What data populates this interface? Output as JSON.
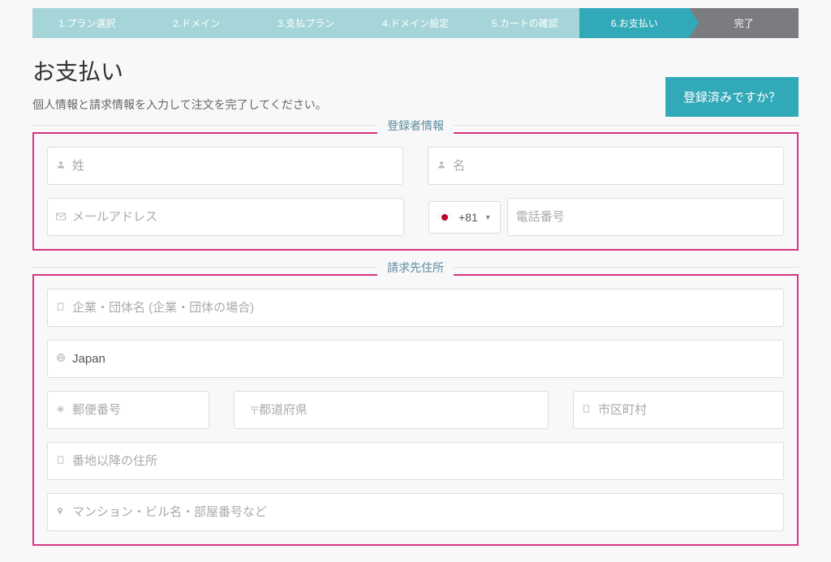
{
  "progress": {
    "steps": [
      {
        "label": "1.プラン選択",
        "state": "completed"
      },
      {
        "label": "2.ドメイン",
        "state": "completed"
      },
      {
        "label": "3.支払プラン",
        "state": "completed"
      },
      {
        "label": "4.ドメイン設定",
        "state": "completed"
      },
      {
        "label": "5.カートの確認",
        "state": "completed"
      },
      {
        "label": "6.お支払い",
        "state": "active"
      },
      {
        "label": "完了",
        "state": "inactive"
      }
    ]
  },
  "header": {
    "title": "お支払い",
    "subtitle": "個人情報と請求情報を入力して注文を完了してください。",
    "registered_button": "登録済みですか？"
  },
  "registrant_section": {
    "legend": "登録者情報",
    "last_name_placeholder": "姓",
    "first_name_placeholder": "名",
    "email_placeholder": "メールアドレス",
    "phone_country_code": "+81",
    "phone_placeholder": "電話番号"
  },
  "billing_section": {
    "legend": "請求先住所",
    "company_placeholder": "企業・団体名 (企業・団体の場合)",
    "country_value": "Japan",
    "postal_placeholder": "郵便番号",
    "prefecture_placeholder": "都道府県",
    "city_placeholder": "市区町村",
    "address_placeholder": "番地以降の住所",
    "building_placeholder": "マンション・ビル名・部屋番号など"
  }
}
